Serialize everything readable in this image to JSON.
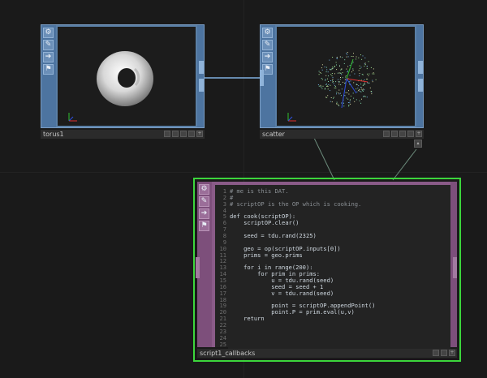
{
  "nodes": {
    "torus": {
      "name": "torus1"
    },
    "scatter": {
      "name": "scatter"
    },
    "script": {
      "name": "script1_callbacks",
      "line_numbers": [
        "1",
        "2",
        "3",
        "4",
        "5",
        "6",
        "7",
        "8",
        "9",
        "10",
        "11",
        "12",
        "13",
        "14",
        "15",
        "16",
        "17",
        "18",
        "19",
        "20",
        "21",
        "22",
        "23",
        "24",
        "25"
      ],
      "code_lines": [
        "# me is this DAT.",
        "#",
        "# scriptOP is the OP which is cooking.",
        "",
        "def cook(scriptOP):",
        "    scriptOP.clear()",
        "",
        "    seed = tdu.rand(2325)",
        "",
        "    geo = op(scriptOP.inputs[0])",
        "    prims = geo.prims",
        "",
        "    for i in range(200):",
        "        for prim in prims:",
        "            u = tdu.rand(seed)",
        "            seed = seed + 1",
        "            v = tdu.rand(seed)",
        "",
        "            point = scriptOP.appendPoint()",
        "            point.P = prim.eval(u,v)",
        "    return",
        "",
        "",
        "",
        ""
      ]
    }
  },
  "strip_icons": [
    "gear-icon",
    "pencil-icon",
    "arrow-icon",
    "flags-icon"
  ],
  "colors": {
    "sop_node": "#5a7fa6",
    "dat_node": "#8a5b88",
    "selected_outline": "#3cd63c",
    "background": "#1a1a1a"
  }
}
